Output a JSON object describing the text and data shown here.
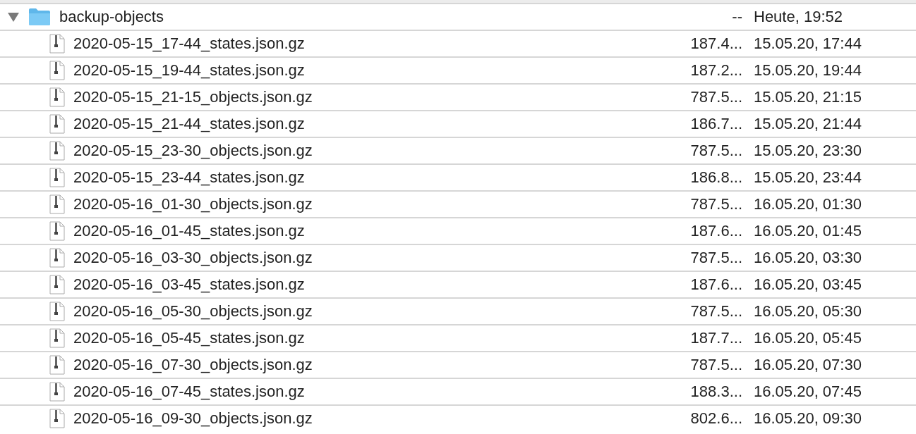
{
  "folder": {
    "name": "backup-objects",
    "size": "--",
    "modified": "Heute, 19:52",
    "expanded": true,
    "children": [
      {
        "name": "2020-05-15_17-44_states.json.gz",
        "size": "187.4...",
        "modified": "15.05.20, 17:44"
      },
      {
        "name": "2020-05-15_19-44_states.json.gz",
        "size": "187.2...",
        "modified": "15.05.20, 19:44"
      },
      {
        "name": "2020-05-15_21-15_objects.json.gz",
        "size": "787.5...",
        "modified": "15.05.20, 21:15"
      },
      {
        "name": "2020-05-15_21-44_states.json.gz",
        "size": "186.7...",
        "modified": "15.05.20, 21:44"
      },
      {
        "name": "2020-05-15_23-30_objects.json.gz",
        "size": "787.5...",
        "modified": "15.05.20, 23:30"
      },
      {
        "name": "2020-05-15_23-44_states.json.gz",
        "size": "186.8...",
        "modified": "15.05.20, 23:44"
      },
      {
        "name": "2020-05-16_01-30_objects.json.gz",
        "size": "787.5...",
        "modified": "16.05.20, 01:30"
      },
      {
        "name": "2020-05-16_01-45_states.json.gz",
        "size": "187.6...",
        "modified": "16.05.20, 01:45"
      },
      {
        "name": "2020-05-16_03-30_objects.json.gz",
        "size": "787.5...",
        "modified": "16.05.20, 03:30"
      },
      {
        "name": "2020-05-16_03-45_states.json.gz",
        "size": "187.6...",
        "modified": "16.05.20, 03:45"
      },
      {
        "name": "2020-05-16_05-30_objects.json.gz",
        "size": "787.5...",
        "modified": "16.05.20, 05:30"
      },
      {
        "name": "2020-05-16_05-45_states.json.gz",
        "size": "187.7...",
        "modified": "16.05.20, 05:45"
      },
      {
        "name": "2020-05-16_07-30_objects.json.gz",
        "size": "787.5...",
        "modified": "16.05.20, 07:30"
      },
      {
        "name": "2020-05-16_07-45_states.json.gz",
        "size": "188.3...",
        "modified": "16.05.20, 07:45"
      },
      {
        "name": "2020-05-16_09-30_objects.json.gz",
        "size": "802.6...",
        "modified": "16.05.20, 09:30"
      }
    ]
  }
}
